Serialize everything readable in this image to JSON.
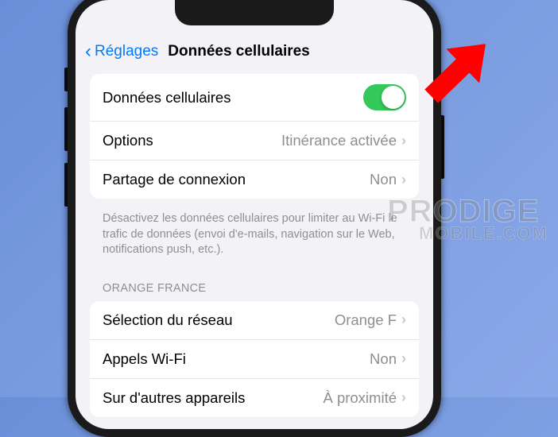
{
  "nav": {
    "back_label": "Réglages",
    "title": "Données cellulaires"
  },
  "group1": {
    "cellular_data": {
      "label": "Données cellulaires",
      "enabled": true
    },
    "options": {
      "label": "Options",
      "value": "Itinérance activée"
    },
    "hotspot": {
      "label": "Partage de connexion",
      "value": "Non"
    }
  },
  "group1_footer": "Désactivez les données cellulaires pour limiter au Wi-Fi le trafic de données (envoi d'e-mails, navigation sur le Web, notifications push, etc.).",
  "section2_header": "ORANGE FRANCE",
  "group2": {
    "network_selection": {
      "label": "Sélection du réseau",
      "value": "Orange F"
    },
    "wifi_calling": {
      "label": "Appels Wi-Fi",
      "value": "Non"
    },
    "other_devices": {
      "label": "Sur d'autres appareils",
      "value": "À proximité"
    }
  },
  "watermark": {
    "line1": "PRODIGE",
    "line2": "MOBILE.COM"
  },
  "colors": {
    "accent": "#007aff",
    "toggle_on": "#34c759",
    "arrow": "#ff0000"
  }
}
